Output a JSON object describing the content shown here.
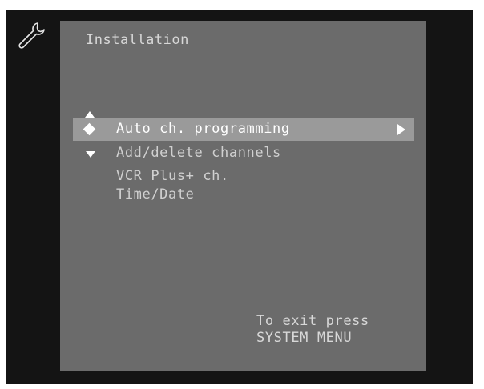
{
  "header": {
    "icon": "wrench-icon",
    "title": "Installation"
  },
  "menu": {
    "scroll_up_icon": "triangle-up-icon",
    "scroll_down_icon": "triangle-down-icon",
    "selected_marker_icon": "diamond-icon",
    "submenu_icon": "triangle-right-icon",
    "items": [
      {
        "label": "Auto ch. programming",
        "selected": true
      },
      {
        "label": "Add/delete channels",
        "selected": false
      },
      {
        "label": "VCR Plus+ ch.",
        "selected": false
      },
      {
        "label": "Time/Date",
        "selected": false
      }
    ]
  },
  "footer": {
    "line1": "To exit press",
    "line2": "SYSTEM MENU"
  },
  "colors": {
    "screen_background": "#141414",
    "panel_background": "#6b6b6b",
    "selection_highlight": "#9a9a9a",
    "text": "#d0d0d0",
    "selected_text": "#ffffff"
  }
}
